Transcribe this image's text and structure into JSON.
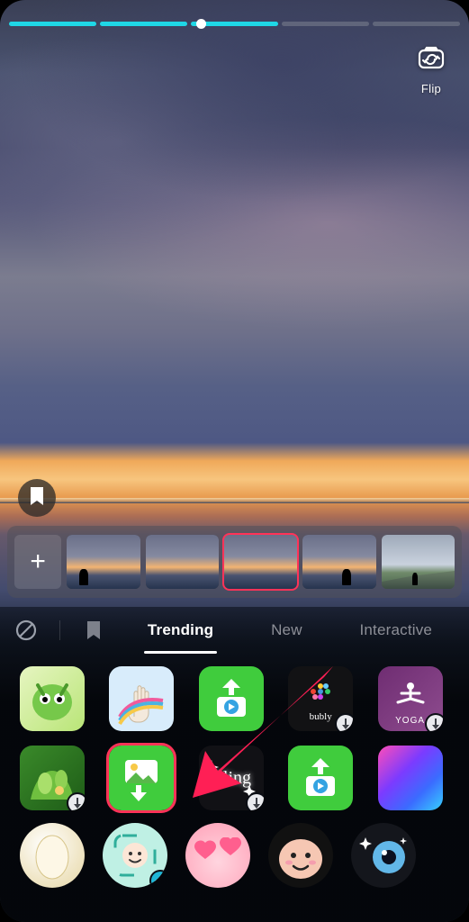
{
  "camera": {
    "flip_label": "Flip",
    "progress_segments": [
      true,
      true,
      true,
      false,
      false
    ]
  },
  "thumbnail_strip": {
    "add_label": "+",
    "selected_index": 2,
    "thumbs": [
      "sunset-1",
      "sunset-2",
      "sunset-3",
      "sunset-4",
      "landscape"
    ]
  },
  "effects_panel": {
    "tabs": {
      "trending": "Trending",
      "new": "New",
      "interactive": "Interactive",
      "active": "trending"
    },
    "row1": [
      {
        "id": "dragon",
        "bg": "#d7f0b2",
        "downloadable": false
      },
      {
        "id": "rainbow-hand",
        "bg": "#cfe9ff",
        "downloadable": false
      },
      {
        "id": "media-up",
        "bg": "#3ac93a",
        "downloadable": false
      },
      {
        "id": "bubly",
        "bg": "#121214",
        "downloadable": true,
        "text": "bubly"
      },
      {
        "id": "yoga",
        "bg": "#7b3f7d",
        "downloadable": true,
        "text": "YOGA"
      }
    ],
    "row2": [
      {
        "id": "jungle",
        "bg": "#2f7a25",
        "downloadable": true
      },
      {
        "id": "image-down",
        "bg": "#3ac83a",
        "downloadable": false,
        "selected": true
      },
      {
        "id": "bling",
        "bg": "#111114",
        "downloadable": true,
        "text": "Bling"
      },
      {
        "id": "media-up-2",
        "bg": "#3ac93a",
        "downloadable": false
      },
      {
        "id": "gradient",
        "bg": "linear",
        "downloadable": false
      }
    ],
    "row3": [
      {
        "id": "egg",
        "bg": "#efead6"
      },
      {
        "id": "face-square",
        "bg": "#bfeee3",
        "checked": true
      },
      {
        "id": "hearts",
        "bg": "#ff9fb0"
      },
      {
        "id": "blob-face",
        "bg": "#f6c7b6"
      },
      {
        "id": "sparkle-eye",
        "bg": "#121418"
      }
    ]
  }
}
